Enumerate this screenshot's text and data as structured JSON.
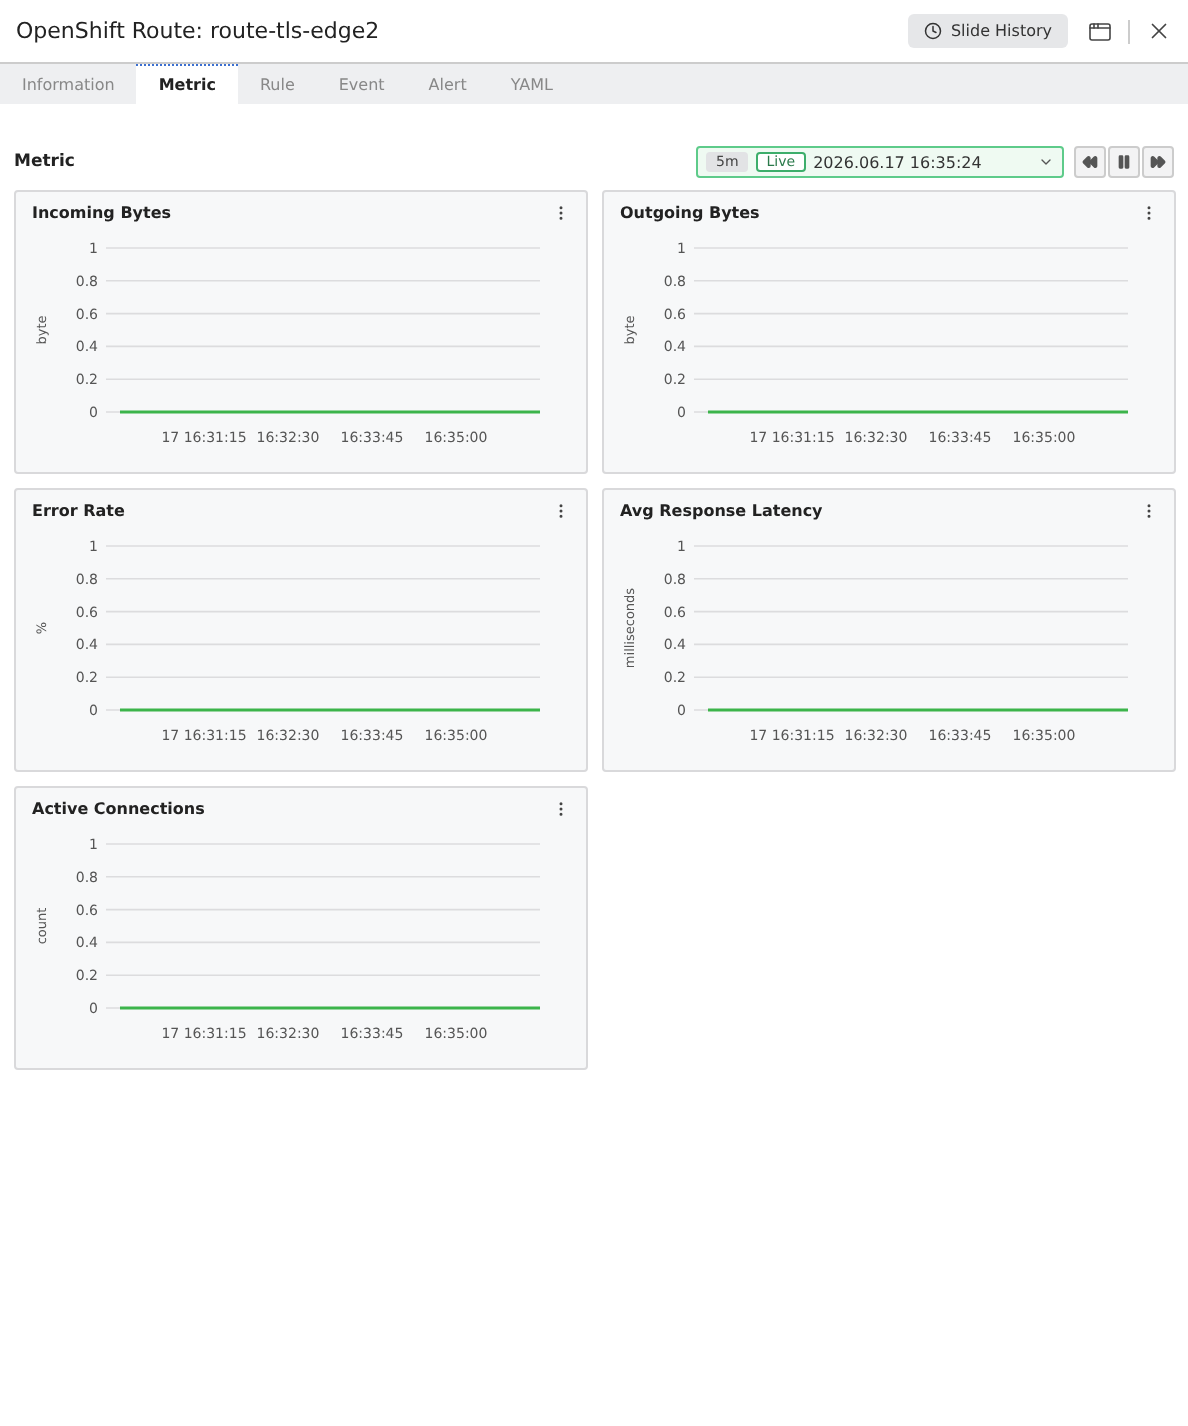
{
  "window": {
    "title": "OpenShift Route: route-tls-edge2",
    "history_button": "Slide History"
  },
  "tabs": [
    {
      "label": "Information",
      "selected": false
    },
    {
      "label": "Metric",
      "selected": true
    },
    {
      "label": "Rule",
      "selected": false
    },
    {
      "label": "Event",
      "selected": false
    },
    {
      "label": "Alert",
      "selected": false
    },
    {
      "label": "YAML",
      "selected": false
    }
  ],
  "section": {
    "title": "Metric"
  },
  "time_control": {
    "range": "5m",
    "live": "Live",
    "datetime": "2026.06.17 16:35:24"
  },
  "panels": [
    {
      "title": "Incoming Bytes",
      "chart_data": {
        "type": "line",
        "grid": true,
        "ylabel": "byte",
        "categories": [
          null,
          "17 16:31:15",
          "16:32:30",
          "16:33:45",
          "16:35:00",
          null
        ],
        "ylim": [
          0,
          1
        ],
        "yticks": [
          0,
          0.2,
          0.4,
          0.6,
          0.8,
          1
        ],
        "series": [
          {
            "color": "#3cb44b",
            "values": [
              0,
              0,
              0,
              0,
              0,
              0
            ]
          }
        ]
      }
    },
    {
      "title": "Outgoing Bytes",
      "chart_data": {
        "type": "line",
        "grid": true,
        "ylabel": "byte",
        "categories": [
          null,
          "17 16:31:15",
          "16:32:30",
          "16:33:45",
          "16:35:00",
          null
        ],
        "ylim": [
          0,
          1
        ],
        "yticks": [
          0,
          0.2,
          0.4,
          0.6,
          0.8,
          1
        ],
        "series": [
          {
            "color": "#3cb44b",
            "values": [
              0,
              0,
              0,
              0,
              0,
              0
            ]
          }
        ]
      }
    },
    {
      "title": "Error Rate",
      "chart_data": {
        "type": "line",
        "grid": true,
        "ylabel": "%",
        "categories": [
          null,
          "17 16:31:15",
          "16:32:30",
          "16:33:45",
          "16:35:00",
          null
        ],
        "ylim": [
          0,
          1
        ],
        "yticks": [
          0,
          0.2,
          0.4,
          0.6,
          0.8,
          1
        ],
        "series": [
          {
            "color": "#3cb44b",
            "values": [
              0,
              0,
              0,
              0,
              0,
              0
            ]
          }
        ]
      }
    },
    {
      "title": "Avg Response Latency",
      "chart_data": {
        "type": "line",
        "grid": true,
        "ylabel": "milliseconds",
        "categories": [
          null,
          "17 16:31:15",
          "16:32:30",
          "16:33:45",
          "16:35:00",
          null
        ],
        "ylim": [
          0,
          1
        ],
        "yticks": [
          0,
          0.2,
          0.4,
          0.6,
          0.8,
          1
        ],
        "series": [
          {
            "color": "#3cb44b",
            "values": [
              0,
              0,
              0,
              0,
              0,
              0
            ]
          }
        ]
      }
    },
    {
      "title": "Active Connections",
      "chart_data": {
        "type": "line",
        "grid": true,
        "ylabel": "count",
        "categories": [
          null,
          "17 16:31:15",
          "16:32:30",
          "16:33:45",
          "16:35:00",
          null
        ],
        "ylim": [
          0,
          1
        ],
        "yticks": [
          0,
          0.2,
          0.4,
          0.6,
          0.8,
          1
        ],
        "series": [
          {
            "color": "#3cb44b",
            "values": [
              0,
              0,
              0,
              0,
              0,
              0
            ]
          }
        ]
      }
    }
  ]
}
